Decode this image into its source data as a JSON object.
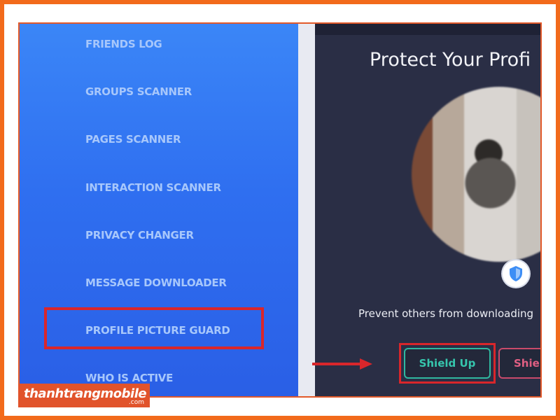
{
  "sidebar": {
    "items": [
      {
        "label": "FRIENDS LOG"
      },
      {
        "label": "GROUPS SCANNER"
      },
      {
        "label": "PAGES SCANNER"
      },
      {
        "label": "INTERACTION SCANNER"
      },
      {
        "label": "PRIVACY CHANGER"
      },
      {
        "label": "MESSAGE DOWNLOADER"
      },
      {
        "label": "PROFILE PICTURE GUARD"
      },
      {
        "label": "WHO IS ACTIVE"
      }
    ]
  },
  "panel": {
    "title": "Protect Your Profi",
    "description": "Prevent others from downloading",
    "shield_up_label": "Shield Up",
    "shield_down_label": "Shiel"
  },
  "watermark": {
    "brand": "thanhtrangmobile",
    "suffix": ".com"
  },
  "colors": {
    "frame": "#f26a1b",
    "sidebar": "#2f6ff0",
    "panel": "#2a2e45",
    "highlight": "#d9262b",
    "shield_up": "#36c6ad",
    "shield_down": "#e05f83"
  },
  "icons": {
    "shield": "shield-icon",
    "arrow": "arrow-right-icon"
  }
}
